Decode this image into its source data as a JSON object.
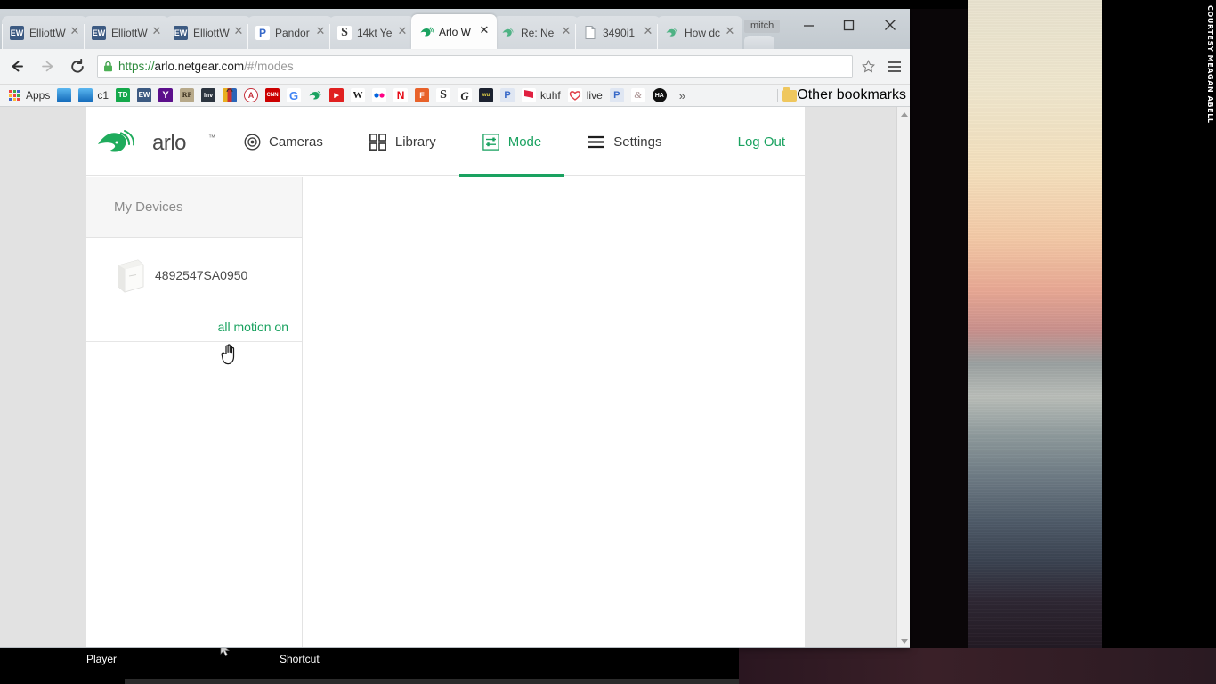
{
  "desktop": {
    "photo_credit": "COURTESY MEAGAN ABELL",
    "icons": [
      {
        "label": "Player"
      },
      {
        "label": "Shortcut"
      }
    ]
  },
  "browser": {
    "profile_name": "mitch",
    "window_controls": {
      "minimize": "—",
      "maximize": "□",
      "close": "✕"
    },
    "tabs": [
      {
        "title": "ElliottW",
        "favicon": "ew-icon",
        "close": "✕",
        "active": false
      },
      {
        "title": "ElliottW",
        "favicon": "ew-icon",
        "close": "✕",
        "active": false
      },
      {
        "title": "ElliottW",
        "favicon": "ew-icon",
        "close": "✕",
        "active": false
      },
      {
        "title": "Pandor",
        "favicon": "pandora-icon",
        "close": "✕",
        "active": false
      },
      {
        "title": "14kt Ye",
        "favicon": "etsy-icon",
        "close": "✕",
        "active": false
      },
      {
        "title": "Arlo W",
        "favicon": "arlo-icon",
        "close": "✕",
        "active": true
      },
      {
        "title": "Re: Ne",
        "favicon": "arlo-icon",
        "close": "✕",
        "active": false
      },
      {
        "title": "3490i1",
        "favicon": "document-icon",
        "close": "✕",
        "active": false
      },
      {
        "title": "How dc",
        "favicon": "arlo-icon",
        "close": "✕",
        "active": false
      }
    ],
    "toolbar": {
      "back_icon": "back-arrow-icon",
      "forward_icon": "forward-arrow-icon",
      "reload_icon": "reload-icon",
      "lock_icon": "padlock-icon",
      "star_icon": "star-icon",
      "menu_icon": "hamburger-menu-icon",
      "url": {
        "scheme": "https://",
        "host": "arlo.netgear.com",
        "path": "/#/modes"
      }
    },
    "bookmarks": {
      "apps_label": "Apps",
      "overflow_chevron": "»",
      "other_label": "Other bookmarks",
      "items": [
        {
          "label": "",
          "icon": "blue-gradient-icon",
          "color": "#1878c8",
          "glyph": ""
        },
        {
          "label": "c1",
          "icon": "blue-gradient-icon",
          "color": "#1878c8",
          "glyph": ""
        },
        {
          "label": "",
          "icon": "td-bank-icon",
          "color": "#14a84b",
          "glyph": "TD"
        },
        {
          "label": "",
          "icon": "ew-icon",
          "color": "#3c5a82",
          "glyph": "EW"
        },
        {
          "label": "",
          "icon": "yahoo-icon",
          "color": "#5b0f8b",
          "glyph": "Y"
        },
        {
          "label": "",
          "icon": "rp-icon",
          "color": "#b7a98a",
          "glyph": "RP"
        },
        {
          "label": "",
          "icon": "investopedia-icon",
          "color": "#2c3540",
          "glyph": "Inv"
        },
        {
          "label": "",
          "icon": "shopping-bag-icon",
          "color": "#e03c3c",
          "glyph": ""
        },
        {
          "label": "",
          "icon": "a-circle-icon",
          "color": "#ffffff",
          "glyph": "A"
        },
        {
          "label": "",
          "icon": "cnn-icon",
          "color": "#cc0000",
          "glyph": "CNN"
        },
        {
          "label": "",
          "icon": "google-icon",
          "color": "#ffffff",
          "glyph": "G"
        },
        {
          "label": "",
          "icon": "arlo-icon",
          "color": "#ffffff",
          "glyph": ""
        },
        {
          "label": "",
          "icon": "youtube-icon",
          "color": "#e02020",
          "glyph": "▶"
        },
        {
          "label": "",
          "icon": "wikipedia-icon",
          "color": "#ffffff",
          "glyph": "W"
        },
        {
          "label": "",
          "icon": "flickr-icon",
          "color": "#ffffff",
          "glyph": ""
        },
        {
          "label": "",
          "icon": "netflix-icon",
          "color": "#ffffff",
          "glyph": "N"
        },
        {
          "label": "",
          "icon": "flipboard-icon",
          "color": "#e8622a",
          "glyph": "F"
        },
        {
          "label": "",
          "icon": "etsy-icon",
          "color": "#ffffff",
          "glyph": "S"
        },
        {
          "label": "",
          "icon": "script-g-icon",
          "color": "#ffffff",
          "glyph": "G"
        },
        {
          "label": "",
          "icon": "weather-underground-icon",
          "color": "#1c2230",
          "glyph": "wu"
        },
        {
          "label": "",
          "icon": "pandora-icon",
          "color": "#3668c8",
          "glyph": "P"
        },
        {
          "label": "kuhf",
          "icon": "flag-icon",
          "color": "#e02040",
          "glyph": ""
        },
        {
          "label": "live",
          "icon": "heart-icon",
          "color": "#ffffff",
          "glyph": ""
        },
        {
          "label": "",
          "icon": "pandora-icon",
          "color": "#3668c8",
          "glyph": "P"
        },
        {
          "label": "",
          "icon": "script-icon",
          "color": "#ffffff",
          "glyph": ""
        },
        {
          "label": "",
          "icon": "ha-icon",
          "color": "#111111",
          "glyph": "HA"
        }
      ]
    },
    "scrollbar": {
      "up_arrow": "scroll-up-arrow-icon",
      "down_arrow": "scroll-down-arrow-icon"
    }
  },
  "app": {
    "brand": "arlo",
    "brand_tm": "™",
    "nav": [
      {
        "label": "Cameras",
        "icon": "camera-lens-icon",
        "active": false
      },
      {
        "label": "Library",
        "icon": "grid-squares-icon",
        "active": false
      },
      {
        "label": "Mode",
        "icon": "sliders-icon",
        "active": true
      },
      {
        "label": "Settings",
        "icon": "hamburger-lines-icon",
        "active": false
      }
    ],
    "logout_label": "Log Out",
    "sidebar": {
      "header": "My Devices",
      "devices": [
        {
          "name": "4892547SA0950",
          "status": "all motion on",
          "status_color": "#1aa260",
          "thumb": "base-station-icon"
        }
      ]
    },
    "content": {
      "empty": ""
    },
    "accent_color": "#1aa260"
  }
}
